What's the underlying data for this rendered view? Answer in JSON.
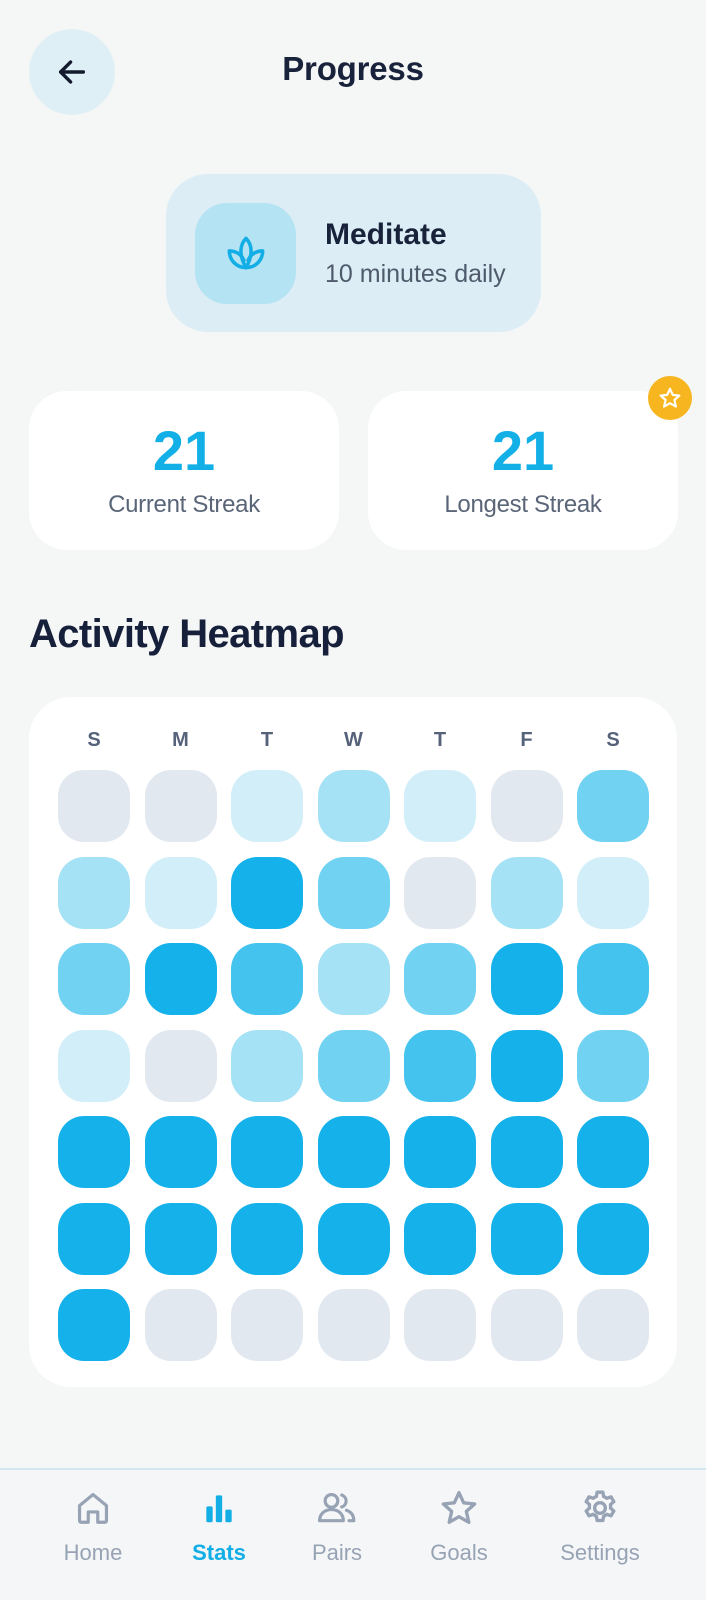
{
  "header": {
    "title": "Progress",
    "back_icon": "arrow-left-icon"
  },
  "habit": {
    "name": "Meditate",
    "description": "10 minutes daily",
    "icon": "lotus-icon"
  },
  "streaks": {
    "current": {
      "value": "21",
      "label": "Current Streak"
    },
    "longest": {
      "value": "21",
      "label": "Longest Streak",
      "badge_icon": "star-icon"
    }
  },
  "heatmap": {
    "title": "Activity Heatmap",
    "days": [
      "S",
      "M",
      "T",
      "W",
      "T",
      "F",
      "S"
    ],
    "levels": [
      [
        0,
        0,
        1,
        2,
        1,
        0,
        3
      ],
      [
        2,
        1,
        4,
        3,
        0,
        2,
        1
      ],
      [
        3,
        4,
        3.5,
        2,
        3,
        4,
        3.5
      ],
      [
        1,
        0,
        2,
        3,
        3.5,
        4,
        3
      ],
      [
        4,
        4,
        4,
        4,
        4,
        4,
        4
      ],
      [
        4,
        4,
        4,
        4,
        4,
        4,
        4
      ],
      [
        4,
        0,
        0,
        0,
        0,
        0,
        0
      ]
    ],
    "colors": {
      "0": "#e2e8f0",
      "1": "#d2eff9",
      "2": "#a5e2f6",
      "3": "#72d2f2",
      "3.5": "#45c3ef",
      "4": "#14b1ea"
    }
  },
  "nav": {
    "active": "Stats",
    "accent": "#12aee6",
    "items": [
      {
        "label": "Home",
        "icon": "home-icon"
      },
      {
        "label": "Stats",
        "icon": "bar-chart-icon"
      },
      {
        "label": "Pairs",
        "icon": "users-icon"
      },
      {
        "label": "Goals",
        "icon": "star-icon"
      },
      {
        "label": "Settings",
        "icon": "gear-icon"
      }
    ]
  }
}
